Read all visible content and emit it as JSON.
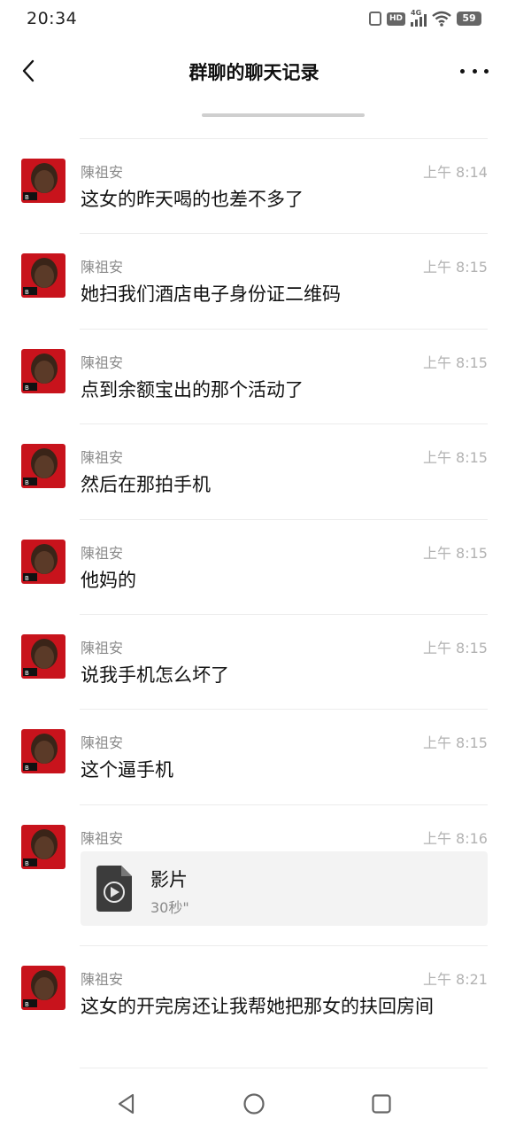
{
  "status_bar": {
    "time": "20:34",
    "network": "4G",
    "hd_label": "HD",
    "battery": "59",
    "icons": [
      "vibrate-icon",
      "hd-icon",
      "signal-icon",
      "wifi-icon",
      "battery-icon"
    ]
  },
  "header": {
    "title": "群聊的聊天记录",
    "back_icon": "chevron-left-icon",
    "more_icon": "more-dots-icon"
  },
  "messages": [
    {
      "sender": "陳祖安",
      "time": "上午 8:14",
      "text": "这女的昨天喝的也差不多了"
    },
    {
      "sender": "陳祖安",
      "time": "上午 8:15",
      "text": "她扫我们酒店电子身份证二维码"
    },
    {
      "sender": "陳祖安",
      "time": "上午 8:15",
      "text": "点到余额宝出的那个活动了"
    },
    {
      "sender": "陳祖安",
      "time": "上午 8:15",
      "text": "然后在那拍手机"
    },
    {
      "sender": "陳祖安",
      "time": "上午 8:15",
      "text": "他妈的"
    },
    {
      "sender": "陳祖安",
      "time": "上午 8:15",
      "text": "说我手机怎么坏了"
    },
    {
      "sender": "陳祖安",
      "time": "上午 8:15",
      "text": "这个逼手机"
    },
    {
      "sender": "陳祖安",
      "time": "上午 8:16",
      "file": {
        "name": "影片",
        "duration": "30秒\""
      }
    },
    {
      "sender": "陳祖安",
      "time": "上午 8:21",
      "text": "这女的开完房还让我帮她把那女的扶回房间"
    }
  ],
  "system_nav": {
    "icons": [
      "nav-back-icon",
      "nav-home-icon",
      "nav-recent-icon"
    ]
  },
  "colors": {
    "background": "#ffffff",
    "text_primary": "#111111",
    "text_secondary": "#8a8a8a",
    "time_text": "#b2b2b2",
    "divider": "#ececec",
    "file_card": "#f3f3f3",
    "avatar_red": "#c8131c"
  }
}
